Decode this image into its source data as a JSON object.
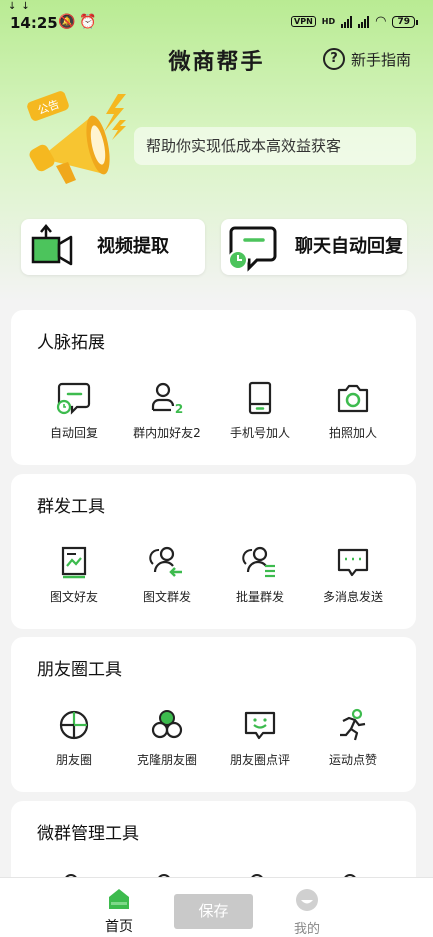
{
  "status_bar": {
    "time": "14:25",
    "vpn": "VPN",
    "network": "HD",
    "battery": "79"
  },
  "header": {
    "title": "微商帮手",
    "guide_label": "新手指南",
    "notice_badge": "公告",
    "notice_text": "帮助你实现低成本高效益获客"
  },
  "quick_actions": {
    "video": "视频提取",
    "chat": "聊天自动回复"
  },
  "sections": [
    {
      "title": "人脉拓展",
      "tools": [
        {
          "label": "自动回复",
          "icon": "chat-clock-icon"
        },
        {
          "label": "群内加好友2",
          "icon": "add-friend-icon"
        },
        {
          "label": "手机号加人",
          "icon": "phone-icon"
        },
        {
          "label": "拍照加人",
          "icon": "camera-icon"
        }
      ]
    },
    {
      "title": "群发工具",
      "tools": [
        {
          "label": "图文好友",
          "icon": "image-doc-icon"
        },
        {
          "label": "图文群发",
          "icon": "users-send-icon"
        },
        {
          "label": "批量群发",
          "icon": "users-list-icon"
        },
        {
          "label": "多消息发送",
          "icon": "message-dots-icon"
        }
      ]
    },
    {
      "title": "朋友圈工具",
      "tools": [
        {
          "label": "朋友圈",
          "icon": "aperture-icon"
        },
        {
          "label": "克隆朋友圈",
          "icon": "clone-circles-icon"
        },
        {
          "label": "朋友圈点评",
          "icon": "smile-message-icon"
        },
        {
          "label": "运动点赞",
          "icon": "runner-icon"
        }
      ]
    },
    {
      "title": "微群管理工具",
      "tools": []
    }
  ],
  "tab_bar": {
    "home": "首页",
    "save": "保存",
    "mine": "我的"
  },
  "colors": {
    "accent": "#3dbb4e",
    "hero_green": "#b9eb93",
    "megaphone": "#f5b820"
  }
}
